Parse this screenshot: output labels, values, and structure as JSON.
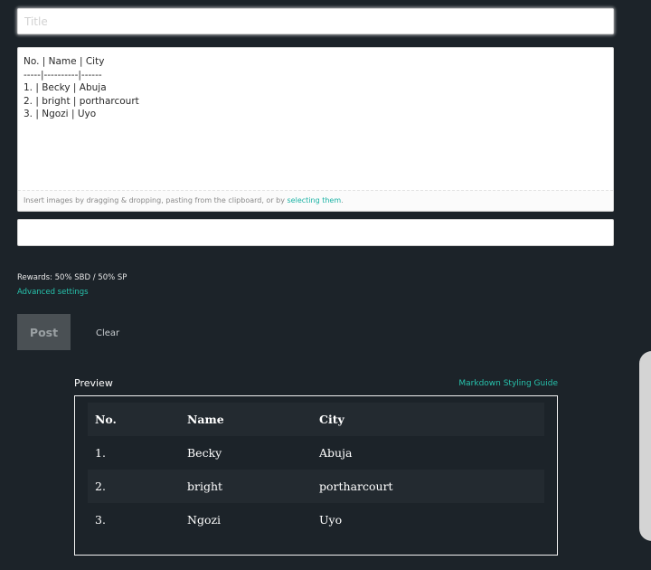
{
  "title_field": {
    "placeholder": "Title",
    "value": ""
  },
  "editor": {
    "content": "No. | Name | City\n-----|----------|------\n1. | Becky | Abuja\n2. | bright | portharcourt\n3. | Ngozi | Uyo",
    "footer_text": "Insert images by dragging & dropping, pasting from the clipboard, or by ",
    "footer_link": "selecting them",
    "footer_end": "."
  },
  "tags_field": {
    "placeholder": "",
    "value": ""
  },
  "rewards": "Rewards: 50% SBD / 50% SP",
  "advanced_settings": "Advanced settings",
  "post_button": "Post",
  "clear_button": "Clear",
  "preview": {
    "label": "Preview",
    "markdown_guide": "Markdown Styling Guide",
    "table": {
      "headers": [
        "No.",
        "Name",
        "City"
      ],
      "rows": [
        [
          "1.",
          "Becky",
          "Abuja"
        ],
        [
          "2.",
          "bright",
          "portharcourt"
        ],
        [
          "3.",
          "Ngozi",
          "Uyo"
        ]
      ]
    }
  },
  "colors": {
    "background": "#1c2329",
    "accent": "#27c3ad",
    "table_row_alt": "#232a30",
    "post_button": "#4a5054"
  }
}
